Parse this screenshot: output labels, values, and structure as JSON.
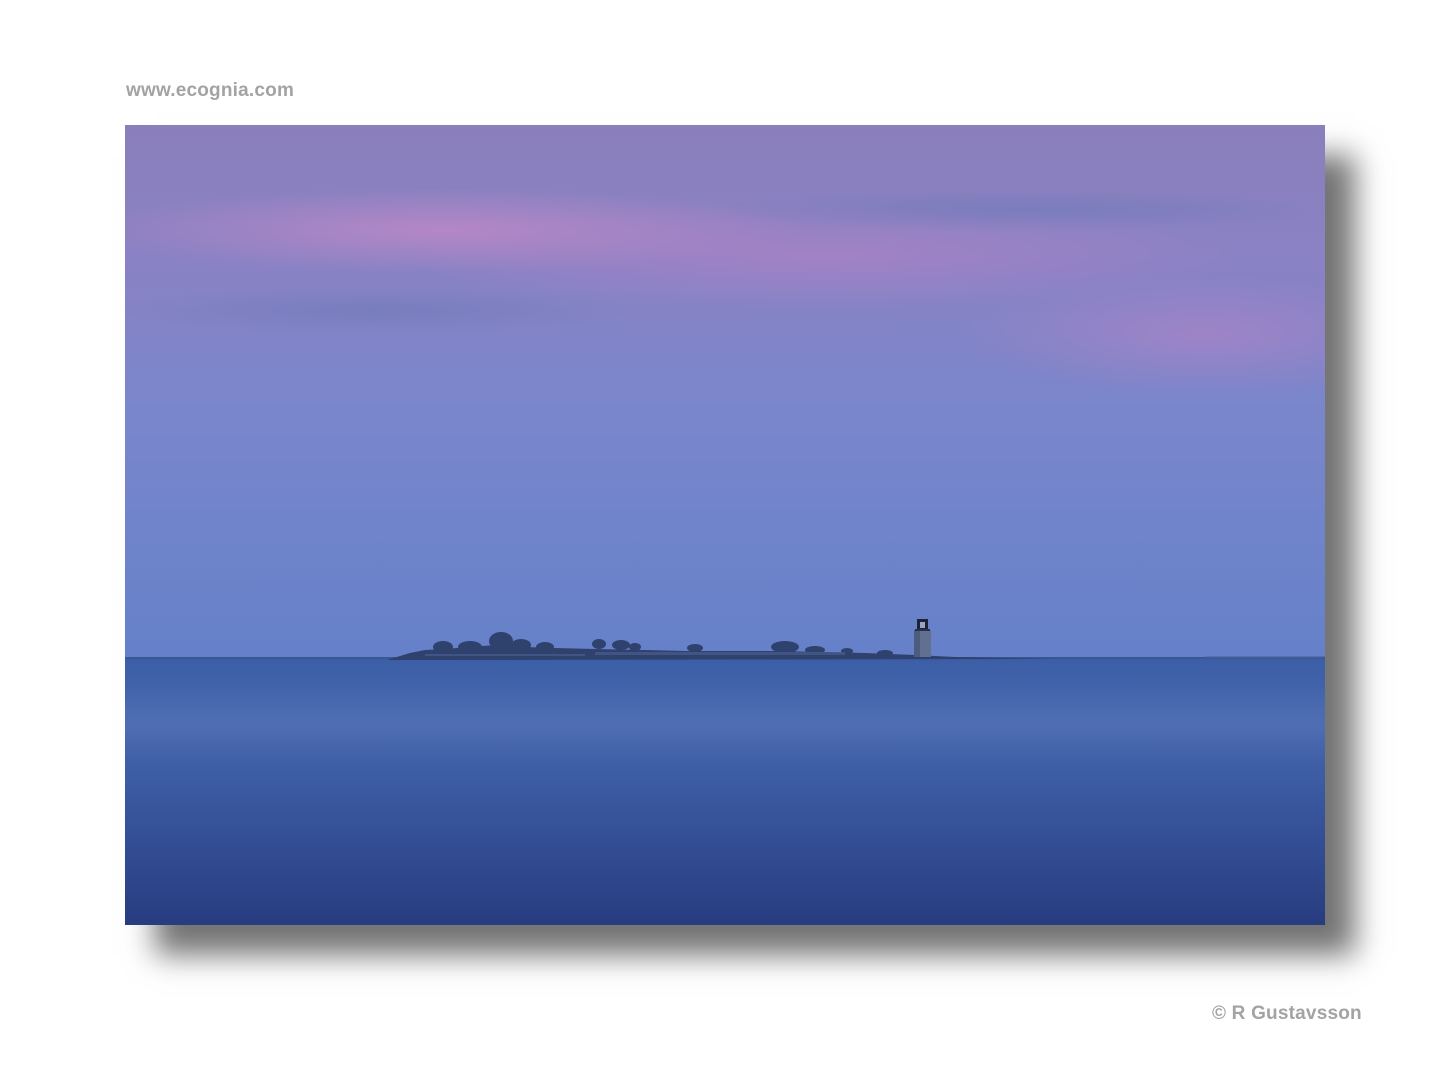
{
  "header": {
    "site_url": "www.ecognia.com"
  },
  "photo": {
    "subject": "island-with-lighthouse-at-dusk",
    "colors": {
      "sky_top": "#8a7fbc",
      "sky_pink": "#b585c6",
      "sky_mid": "#7b86cc",
      "sky_horizon": "#6380c8",
      "sea_top": "#3e62a8",
      "sea_mid": "#3a5ea6",
      "sea_bottom": "#283e82",
      "island": "#2e3f6a"
    }
  },
  "footer": {
    "copyright": "© R Gustavsson"
  }
}
